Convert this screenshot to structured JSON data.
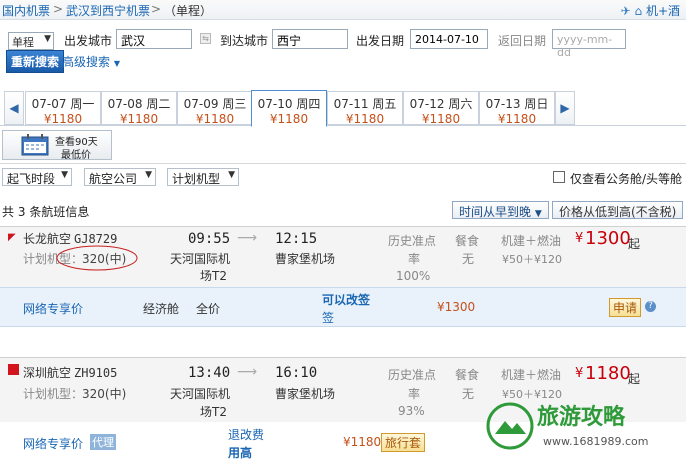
{
  "breadcrumb": {
    "home": "国内机票",
    "route": "武汉到西宁机票",
    "mode": "（单程）",
    "extra": "机+酒"
  },
  "search": {
    "trip_type": "单程",
    "from_label": "出发城市",
    "from_value": "武汉",
    "to_label": "到达城市",
    "to_value": "西宁",
    "depart_label": "出发日期",
    "depart_value": "2014-07-10",
    "return_label": "返回日期",
    "return_placeholder": "yyyy-mm-dd",
    "search_button": "重新搜索",
    "advanced": "高级搜索"
  },
  "dates": [
    {
      "date": "07-07 周一",
      "price": "¥1180"
    },
    {
      "date": "07-08 周二",
      "price": "¥1180"
    },
    {
      "date": "07-09 周三",
      "price": "¥1180"
    },
    {
      "date": "07-10 周四",
      "price": "¥1180"
    },
    {
      "date": "07-11 周五",
      "price": "¥1180"
    },
    {
      "date": "07-12 周六",
      "price": "¥1180"
    },
    {
      "date": "07-13 周日",
      "price": "¥1180"
    }
  ],
  "calendar_button": {
    "line1": "查看90天",
    "line2": "最低价"
  },
  "filters": {
    "takeoff": "起飞时段",
    "airline": "航空公司",
    "aircraft": "计划机型",
    "business_only": "仅查看公务舱/头等舱"
  },
  "summary": {
    "prefix": "共",
    "count": "3",
    "suffix": "条航班信息"
  },
  "sort": {
    "by_time": "时间从早到晚",
    "by_price": "价格从低到高(不含税)"
  },
  "flights": [
    {
      "airline": "长龙航空",
      "flight_no": "GJ8729",
      "aircraft_label": "计划机型：",
      "aircraft": "320(中)",
      "dep_time": "09:55",
      "dep_airport_1": "天河国际机",
      "dep_airport_2": "场T2",
      "arr_time": "12:15",
      "arr_airport": "曹家堡机场",
      "ontime_1": "历史准点",
      "ontime_2": "率",
      "ontime_value": "100%",
      "meal_label": "餐食",
      "meal": "无",
      "tax_label": "机建＋燃油",
      "tax": "¥50＋¥120",
      "price_symbol": "¥",
      "price": "1300",
      "price_suffix": "起",
      "fare": {
        "type": "网络专享价",
        "cabin": "经济舱",
        "discount": "全价",
        "rule_1": "可以改签",
        "rule_2": "签",
        "price": "¥1300",
        "apply": "申请"
      }
    },
    {
      "airline": "深圳航空",
      "flight_no": "ZH9105",
      "aircraft_label": "计划机型：",
      "aircraft": "320(中)",
      "dep_time": "13:40",
      "dep_airport_1": "天河国际机",
      "dep_airport_2": "场T2",
      "arr_time": "16:10",
      "arr_airport": "曹家堡机场",
      "ontime_1": "历史准点",
      "ontime_2": "率",
      "ontime_value": "93%",
      "meal_label": "餐食",
      "meal": "无",
      "tax_label": "机建＋燃油",
      "tax": "¥50＋¥120",
      "price_symbol": "¥",
      "price": "1180",
      "price_suffix": "起",
      "fare": {
        "type": "网络专享价",
        "tag": "代理",
        "rule_1": "退改费",
        "rule_2": "用高",
        "price": "¥1180",
        "apply": "旅行套"
      }
    }
  ],
  "watermark": {
    "brand": "旅游攻略",
    "url": "www.1681989.com"
  },
  "colors": {
    "accent": "#1a66b3",
    "price": "#c8000a",
    "tab_price": "#c4501a"
  }
}
